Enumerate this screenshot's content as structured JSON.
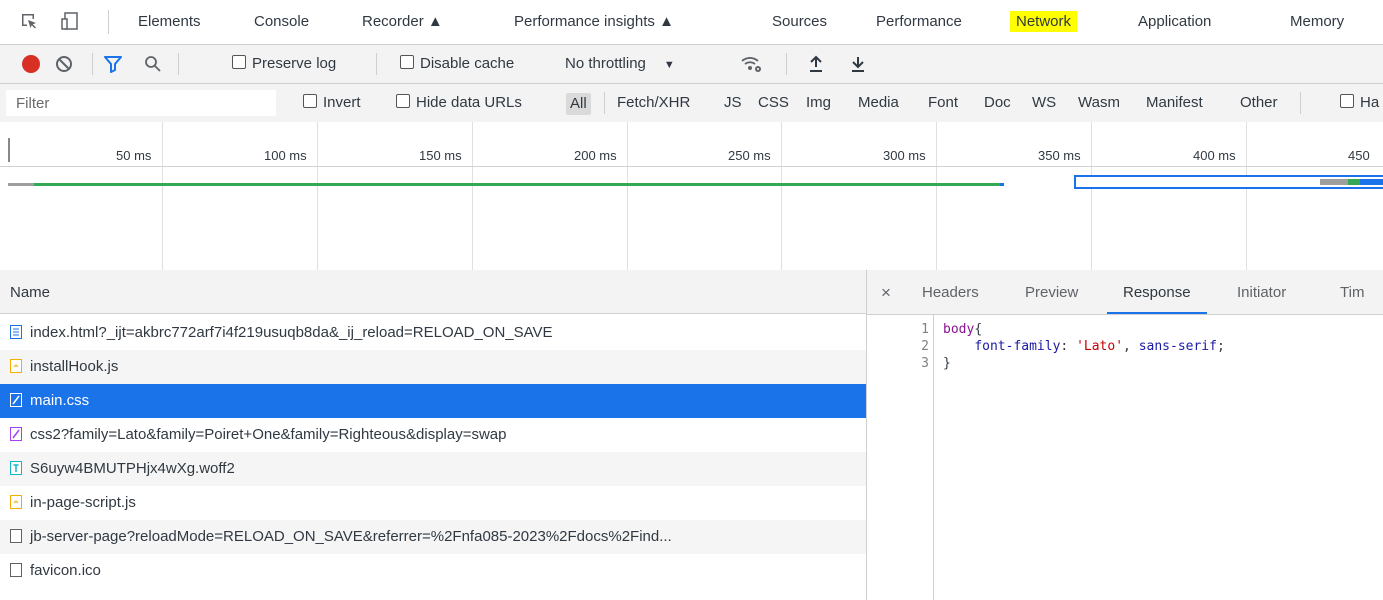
{
  "tabs": [
    {
      "label": "Elements"
    },
    {
      "label": "Console"
    },
    {
      "label": "Recorder"
    },
    {
      "label": "Performance insights"
    },
    {
      "label": "Sources"
    },
    {
      "label": "Performance"
    },
    {
      "label": "Network"
    },
    {
      "label": "Application"
    },
    {
      "label": "Memory"
    }
  ],
  "toolbar": {
    "preserve_log": "Preserve log",
    "disable_cache": "Disable cache",
    "throttling": "No throttling"
  },
  "filterbar": {
    "placeholder": "Filter",
    "invert": "Invert",
    "hide_data_urls": "Hide data URLs",
    "types": [
      "All",
      "Fetch/XHR",
      "JS",
      "CSS",
      "Img",
      "Media",
      "Font",
      "Doc",
      "WS",
      "Wasm",
      "Manifest",
      "Other"
    ],
    "has_blocked": "Ha"
  },
  "timeline": {
    "ticks": [
      "50 ms",
      "100 ms",
      "150 ms",
      "200 ms",
      "250 ms",
      "300 ms",
      "350 ms",
      "400 ms",
      "450"
    ]
  },
  "requests": {
    "header": "Name",
    "rows": [
      {
        "name": "index.html?_ijt=akbrc772arf7i4f219usuqb8da&_ij_reload=RELOAD_ON_SAVE",
        "type": "doc"
      },
      {
        "name": "installHook.js",
        "type": "js"
      },
      {
        "name": "main.css",
        "type": "css"
      },
      {
        "name": "css2?family=Lato&family=Poiret+One&family=Righteous&display=swap",
        "type": "css2"
      },
      {
        "name": "S6uyw4BMUTPHjx4wXg.woff2",
        "type": "font"
      },
      {
        "name": "in-page-script.js",
        "type": "js"
      },
      {
        "name": "jb-server-page?reloadMode=RELOAD_ON_SAVE&referrer=%2Fnfa085-2023%2Fdocs%2Find...",
        "type": "other"
      },
      {
        "name": "favicon.ico",
        "type": "other"
      }
    ]
  },
  "details": {
    "close": "×",
    "tabs": [
      "Headers",
      "Preview",
      "Response",
      "Initiator",
      "Tim"
    ],
    "line_numbers": [
      "1",
      "2",
      "3"
    ],
    "code": {
      "l1_sel": "body",
      "l1_brace": "{",
      "l2_prop": "font-family",
      "l2_colon": ": ",
      "l2_str": "'Lato'",
      "l2_comma": ", ",
      "l2_kw": "sans-serif",
      "l2_semi": ";",
      "l3": "}"
    }
  },
  "colors": {
    "accent": "#1a73e8",
    "record": "#d93025",
    "highlight": "#ffff00"
  }
}
